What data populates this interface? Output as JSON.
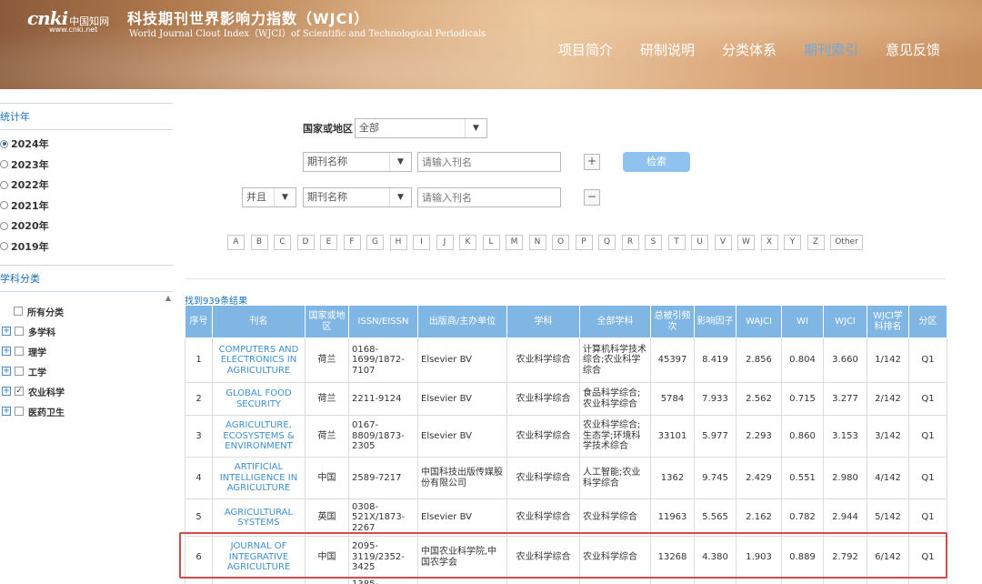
{
  "header": {
    "logo_mark": "cnki",
    "logo_cn": "中国知网",
    "logo_url": "www.cnki.net",
    "title_cn": "科技期刊世界影响力指数（WJCI）",
    "title_en": "World Journal Clout Index（WJCI）of Scientific and Technological Periodicals",
    "nav": [
      "项目简介",
      "研制说明",
      "分类体系",
      "期刊索引",
      "意见反馈"
    ],
    "active_nav": "期刊索引"
  },
  "sidebar": {
    "year_heading": "统计年",
    "years": [
      "2024年",
      "2023年",
      "2022年",
      "2021年",
      "2020年",
      "2019年"
    ],
    "selected_year": "2024年",
    "subject_heading": "学科分类",
    "all_label": "所有分类",
    "subjects": [
      {
        "label": "多学科",
        "checked": false
      },
      {
        "label": "理学",
        "checked": false
      },
      {
        "label": "工学",
        "checked": false
      },
      {
        "label": "农业科学",
        "checked": true
      },
      {
        "label": "医药卫生",
        "checked": false
      }
    ]
  },
  "search": {
    "country_label": "国家或地区",
    "country_value": "全部",
    "field1": "期刊名称",
    "input1_placeholder": "请输入刊名",
    "plus": "+",
    "search_button": "检索",
    "logic": "并且",
    "field2": "期刊名称",
    "input2_placeholder": "请输入刊名",
    "minus": "−",
    "letters": [
      "A",
      "B",
      "C",
      "D",
      "E",
      "F",
      "G",
      "H",
      "I",
      "J",
      "K",
      "L",
      "M",
      "N",
      "O",
      "P",
      "Q",
      "R",
      "S",
      "T",
      "U",
      "V",
      "W",
      "X",
      "Y",
      "Z",
      "Other"
    ],
    "result_count": "找到939条结果"
  },
  "table": {
    "headers": [
      "序号",
      "刊名",
      "国家或地区",
      "ISSN/EISSN",
      "出版商/主办单位",
      "学科",
      "全部学科",
      "总被引频次",
      "影响因子",
      "WAJCI",
      "WI",
      "WJCI",
      "WJCI学科排名",
      "分区"
    ],
    "rows": [
      [
        "1",
        "COMPUTERS AND ELECTRONICS IN AGRICULTURE",
        "荷兰",
        "0168-1699/1872-7107",
        "Elsevier BV",
        "农业科学综合",
        "计算机科学技术综合;农业科学综合",
        "45397",
        "8.419",
        "2.856",
        "0.804",
        "3.660",
        "1/142",
        "Q1"
      ],
      [
        "2",
        "GLOBAL FOOD SECURITY",
        "荷兰",
        "2211-9124",
        "Elsevier BV",
        "农业科学综合",
        "食品科学综合;农业科学综合",
        "5784",
        "7.933",
        "2.562",
        "0.715",
        "3.277",
        "2/142",
        "Q1"
      ],
      [
        "3",
        "AGRICULTURE, ECOSYSTEMS & ENVIRONMENT",
        "荷兰",
        "0167-8809/1873-2305",
        "Elsevier BV",
        "农业科学综合",
        "农业科学综合;生态学;环境科学技术综合",
        "33101",
        "5.977",
        "2.293",
        "0.860",
        "3.153",
        "3/142",
        "Q1"
      ],
      [
        "4",
        "ARTIFICIAL INTELLIGENCE IN AGRICULTURE",
        "中国",
        "2589-7217",
        "中国科技出版传媒股份有限公司",
        "农业科学综合",
        "人工智能;农业科学综合",
        "1362",
        "9.745",
        "2.429",
        "0.551",
        "2.980",
        "4/142",
        "Q1"
      ],
      [
        "5",
        "AGRICULTURAL SYSTEMS",
        "英国",
        "0308-521X/1873-2267",
        "Elsevier BV",
        "农业科学综合",
        "农业科学综合",
        "11963",
        "5.565",
        "2.162",
        "0.782",
        "2.944",
        "5/142",
        "Q1"
      ],
      [
        "6",
        "JOURNAL OF INTEGRATIVE AGRICULTURE",
        "中国",
        "2095-3119/2352-3425",
        "中国农业科学院,中国农学会",
        "农业科学综合",
        "农业科学综合",
        "13268",
        "4.380",
        "1.903",
        "0.889",
        "2.792",
        "6/142",
        "Q1"
      ],
      [
        "",
        "",
        "",
        "1385-",
        "",
        "",
        "",
        "",
        "",
        "",
        "",
        "",
        "",
        ""
      ]
    ],
    "row_heights": [
      49,
      36,
      46,
      46,
      41,
      46,
      15
    ]
  }
}
